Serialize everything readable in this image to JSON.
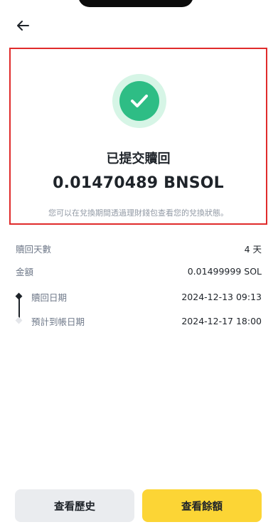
{
  "success": {
    "title": "已提交贖回",
    "amount": "0.01470489 BNSOL",
    "hint": "您可以在兌換期間透過理財錢包查看您的兌換狀態。"
  },
  "details": {
    "redeem_days": {
      "label": "贖回天數",
      "value": "4 天"
    },
    "amount": {
      "label": "金額",
      "value": "0.01499999 SOL"
    }
  },
  "timeline": {
    "redeem_date": {
      "label": "贖回日期",
      "value": "2024-12-13 09:13"
    },
    "expected_date": {
      "label": "預計到帳日期",
      "value": "2024-12-17 18:00"
    }
  },
  "actions": {
    "history_label": "查看歷史",
    "balance_label": "查看餘額"
  },
  "colors": {
    "success_green": "#2ebd85",
    "primary_yellow": "#fcd535",
    "highlight_red": "#e02b2b"
  },
  "icons": {
    "back": "arrow-left-icon",
    "success": "checkmark-icon"
  }
}
